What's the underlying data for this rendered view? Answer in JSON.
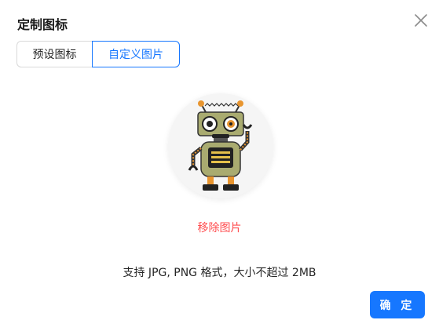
{
  "dialog": {
    "title": "定制图标",
    "close_icon": "close-icon"
  },
  "tabs": [
    {
      "label": "预设图标",
      "active": false
    },
    {
      "label": "自定义图片",
      "active": true
    }
  ],
  "preview": {
    "image": "robot-icon",
    "remove_label": "移除图片"
  },
  "hint": "支持 JPG, PNG 格式，大小不超过 2MB",
  "actions": {
    "confirm_label": "确 定"
  },
  "colors": {
    "accent": "#1677ff",
    "danger": "#ff4d4f"
  }
}
